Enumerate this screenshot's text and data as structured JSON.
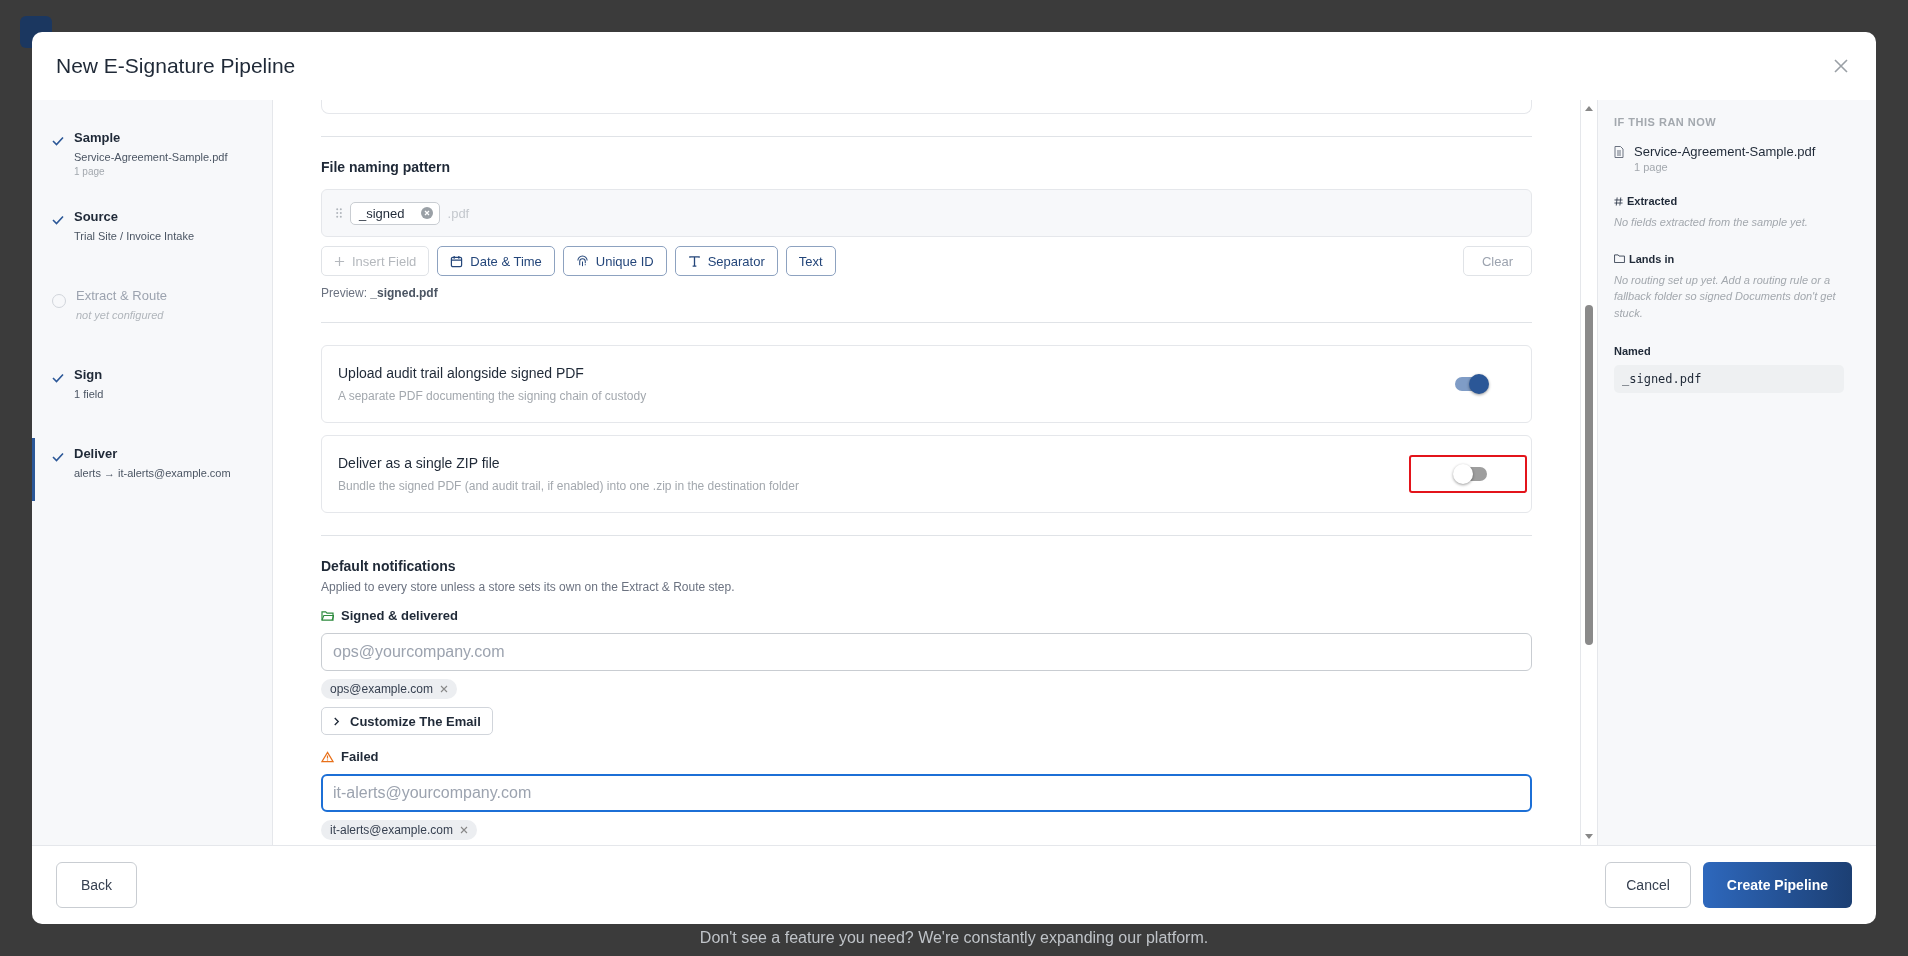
{
  "window": {
    "title": "New E-Signature Pipeline"
  },
  "steps": [
    {
      "title": "Sample",
      "detail": "Service-Agreement-Sample.pdf",
      "note": "1 page",
      "done": true,
      "selected": false
    },
    {
      "title": "Source",
      "detail": "Trial Site / Invoice Intake",
      "done": true,
      "selected": false
    },
    {
      "title": "Extract & Route",
      "detail": "not yet configured",
      "done": false,
      "selected": false
    },
    {
      "title": "Sign",
      "detail": "1 field",
      "done": true,
      "selected": false
    },
    {
      "title": "Deliver",
      "detail": "alerts → it-alerts@example.com",
      "done": true,
      "selected": true
    }
  ],
  "naming": {
    "title": "File naming pattern",
    "tokens": [
      "_signed"
    ],
    "extension": ".pdf",
    "buttons": [
      {
        "kind": "plus",
        "label": "Insert Field",
        "disabled": true
      },
      {
        "kind": "calendar",
        "label": "Date & Time",
        "disabled": false
      },
      {
        "kind": "fingerprint",
        "label": "Unique ID",
        "disabled": false
      },
      {
        "kind": "type",
        "label": "Separator",
        "disabled": false
      },
      {
        "kind": "none",
        "label": "Text",
        "disabled": false
      }
    ],
    "clear": "Clear",
    "preview_label": "Preview:",
    "preview_value": "_signed.pdf"
  },
  "toggles": [
    {
      "title": "Upload audit trail alongside signed PDF",
      "description": "A separate PDF documenting the signing chain of custody",
      "on": true,
      "highlighted": false
    },
    {
      "title": "Deliver as a single ZIP file",
      "description": "Bundle the signed PDF (and audit trail, if enabled) into one .zip in the destination folder",
      "on": false,
      "highlighted": true
    }
  ],
  "notifications": {
    "title": "Default notifications",
    "description": "Applied to every store unless a store sets its own on the Extract & Route step.",
    "groups": [
      {
        "kind": "success",
        "label": "Signed & delivered",
        "placeholder": "ops@yourcompany.com",
        "focused": false,
        "chips": [
          "ops@example.com"
        ],
        "customize": "Customize The Email"
      },
      {
        "kind": "failure",
        "label": "Failed",
        "placeholder": "it-alerts@yourcompany.com",
        "focused": true,
        "chips": [
          "it-alerts@example.com"
        ]
      }
    ]
  },
  "preview": {
    "heading": "IF THIS RAN NOW",
    "file": "Service-Agreement-Sample.pdf",
    "pages": "1 page",
    "extracted_label": "Extracted",
    "extracted_text": "No fields extracted from the sample yet.",
    "lands_label": "Lands in",
    "lands_text": "No routing set up yet. Add a routing rule or a fallback folder so signed Documents don't get stuck.",
    "named_label": "Named",
    "named_value": "_signed.pdf"
  },
  "footer": {
    "back": "Back",
    "cancel": "Cancel",
    "create": "Create Pipeline"
  },
  "background_text": "Don't see a feature you need? We're constantly expanding our platform."
}
